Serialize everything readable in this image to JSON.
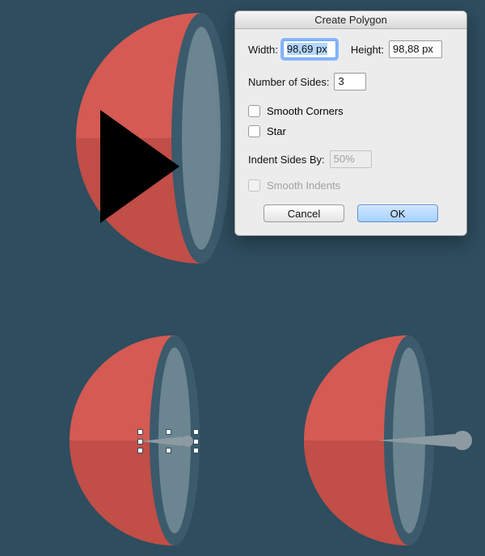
{
  "dialog": {
    "title": "Create Polygon",
    "width_label": "Width:",
    "width_value": "98,69 px",
    "height_label": "Height:",
    "height_value": "98,88 px",
    "sides_label": "Number of Sides:",
    "sides_value": "3",
    "smooth_corners": "Smooth Corners",
    "star": "Star",
    "indent_label": "Indent Sides By:",
    "indent_value": "50%",
    "smooth_indents": "Smooth Indents",
    "cancel": "Cancel",
    "ok": "OK"
  },
  "colors": {
    "canvas_bg": "#2e4d5e",
    "bowl_top": "#d45a53",
    "bowl_bottom": "#c14e47",
    "bowl_rim_outer": "#3b5a6b",
    "bowl_rim_inner": "#6b8591",
    "triangle": "#000000",
    "pointer_gray": "#8c9aa1"
  }
}
